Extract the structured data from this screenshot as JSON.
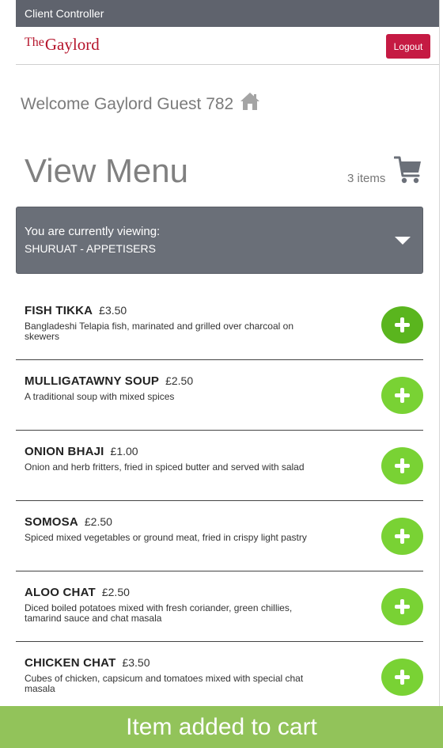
{
  "topbar": {
    "title": "Client Controller"
  },
  "header": {
    "logo_the": "The",
    "logo_name": "Gaylord",
    "logout_label": "Logout"
  },
  "welcome": {
    "text": "Welcome Gaylord Guest 782"
  },
  "page": {
    "title": "View Menu",
    "cart_count": "3 items"
  },
  "viewing": {
    "label": "You are currently viewing:",
    "value": "SHURUAT - APPETISERS"
  },
  "menu_items": [
    {
      "name": "FISH TIKKA",
      "price": "£3.50",
      "description": "Bangladeshi Telapia fish, marinated and grilled over charcoal on skewers"
    },
    {
      "name": "MULLIGATAWNY SOUP",
      "price": "£2.50",
      "description": "A traditional soup with mixed spices"
    },
    {
      "name": "ONION BHAJI",
      "price": "£1.00",
      "description": "Onion and herb fritters, fried in spiced butter and served with salad"
    },
    {
      "name": "SOMOSA",
      "price": "£2.50",
      "description": "Spiced mixed vegetables or ground meat, fried in crispy light pastry"
    },
    {
      "name": "ALOO CHAT",
      "price": "£2.50",
      "description": "Diced boiled potatoes mixed with fresh coriander, green chillies, tamarind sauce and chat masala"
    },
    {
      "name": "CHICKEN CHAT",
      "price": "£3.50",
      "description": "Cubes of chicken, capsicum and tomatoes mixed with special chat masala"
    }
  ],
  "toast": {
    "message": "Item added to cart"
  },
  "colors": {
    "brand": "#b5142b",
    "logout": "#c51a43",
    "add_button": "#79d234",
    "toast": "#92c35a",
    "topbar": "#5f636d"
  },
  "icons": {
    "home": "home-icon",
    "cart": "cart-icon",
    "dropdown": "caret-down-icon",
    "add": "plus-icon"
  }
}
